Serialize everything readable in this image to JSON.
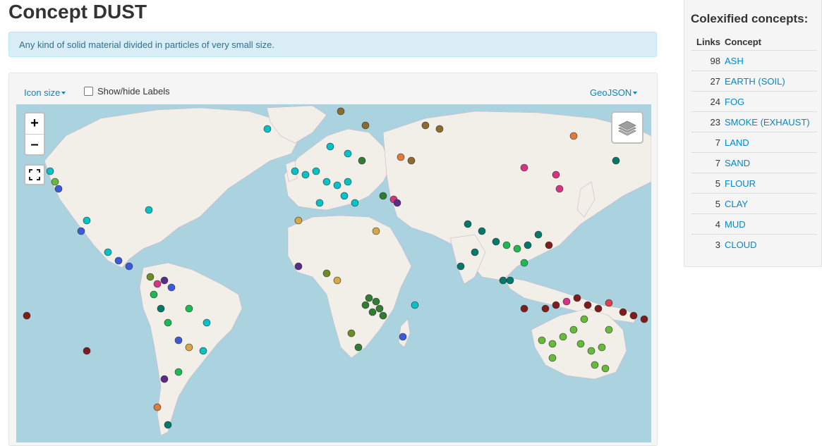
{
  "page": {
    "title": "Concept DUST",
    "description": "Any kind of solid material divided in particles of very small size."
  },
  "map_toolbar": {
    "icon_size_label": "Icon size",
    "show_labels_label": "Show/hide Labels",
    "geojson_label": "GeoJSON"
  },
  "map_controls": {
    "zoom_in": "+",
    "zoom_out": "–"
  },
  "sidebar": {
    "title": "Colexified concepts:",
    "headers": {
      "links": "Links",
      "concept": "Concept"
    },
    "rows": [
      {
        "links": "98",
        "concept": "ASH"
      },
      {
        "links": "27",
        "concept": "EARTH (SOIL)"
      },
      {
        "links": "24",
        "concept": "FOG"
      },
      {
        "links": "23",
        "concept": "SMOKE (EXHAUST)"
      },
      {
        "links": "7",
        "concept": "LAND"
      },
      {
        "links": "7",
        "concept": "SAND"
      },
      {
        "links": "5",
        "concept": "FLOUR"
      },
      {
        "links": "5",
        "concept": "CLAY"
      },
      {
        "links": "4",
        "concept": "MUD"
      },
      {
        "links": "3",
        "concept": "CLOUD"
      }
    ]
  },
  "colors": {
    "accent": "#0088cc",
    "ocean": "#aad3df",
    "land": "#f2efe9",
    "marker_palette": [
      "#00c2c7",
      "#2e7d32",
      "#00796b",
      "#6b8e23",
      "#7f1d1d",
      "#66bb3a",
      "#d4a843",
      "#3b5bdb",
      "#d63384",
      "#e07b39",
      "#5b2c83",
      "#1db954",
      "#8b6b2e"
    ]
  }
}
